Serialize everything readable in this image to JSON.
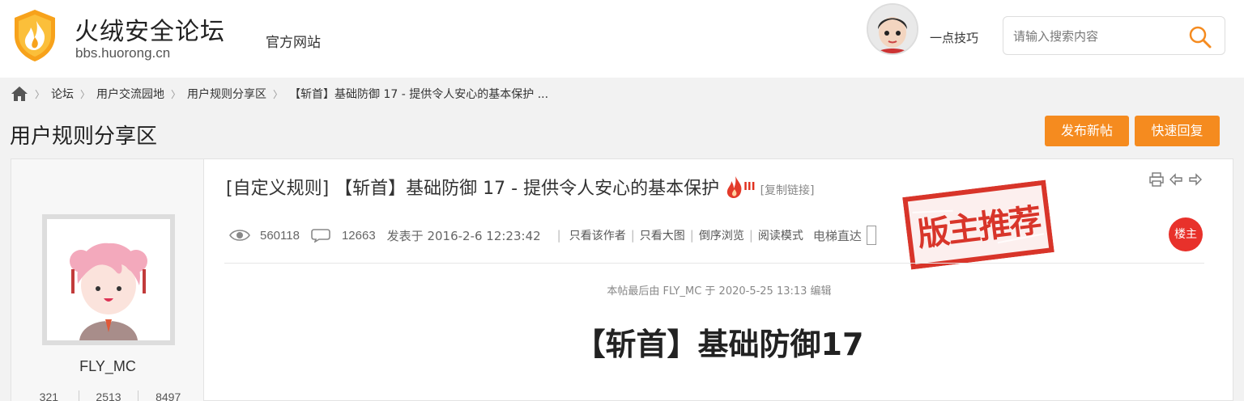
{
  "header": {
    "site_name": "火绒安全论坛",
    "site_url": "bbs.huorong.cn",
    "nav_link": "官方网站",
    "user_name": "一点技巧",
    "search_placeholder": "请输入搜索内容"
  },
  "breadcrumb": {
    "items": [
      "论坛",
      "用户交流园地",
      "用户规则分享区",
      "【斩首】基础防御 17 - 提供令人安心的基本保护 ..."
    ]
  },
  "section": {
    "title": "用户规则分享区",
    "new_post_label": "发布新帖",
    "quick_reply_label": "快速回复"
  },
  "author": {
    "name": "FLY_MC",
    "stats": [
      "321",
      "2513",
      "8497"
    ]
  },
  "post": {
    "title": "[自定义规则] 【斩首】基础防御 17 - 提供令人安心的基本保护",
    "level_mark": "III",
    "copy_link": "[复制链接]",
    "views": "560118",
    "replies": "12663",
    "posted_at": "发表于 2016-2-6 12:23:42",
    "actions": [
      "只看该作者",
      "只看大图",
      "倒序浏览",
      "阅读模式"
    ],
    "jump_label": "电梯直达",
    "stamp_text": "版主推荐",
    "floor_badge": "楼主",
    "edit_note": "本帖最后由 FLY_MC 于 2020-5-25 13:13 编辑",
    "heading": "【斩首】基础防御17"
  },
  "colors": {
    "accent": "#f58b1f",
    "badge": "#e8312b",
    "stamp": "#d8352a"
  }
}
